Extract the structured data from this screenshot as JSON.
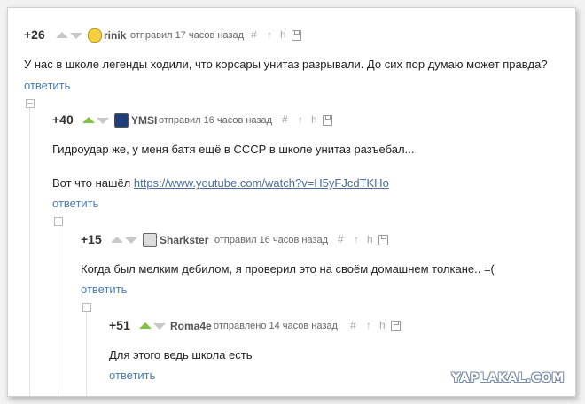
{
  "comments": [
    {
      "score": "+26",
      "author": "rinik",
      "sent": "отправил 17 часов назад",
      "text": "У нас в школе легенды ходили, что корсары унитаз разрывали. До сих пор думаю может правда?",
      "reply": "ответить",
      "avatar_icon": "cartoon-face-icon"
    },
    {
      "score": "+40",
      "author": "YMSI",
      "sent": "отправил 16 часов назад",
      "text": "Гидроудар же, у меня батя ещё в СССР в школе унитаз разъебал...",
      "text2_prefix": "Вот что нашёл ",
      "link": "https://www.youtube.com/watch?v=H5yFJcdTKHo",
      "reply": "ответить",
      "avatar_icon": "monitor-icon"
    },
    {
      "score": "+15",
      "author": "Sharkster",
      "sent": "отправил 16 часов назад",
      "text": "Когда был мелким дебилом, я проверил это на своём домашнем толкане.. =(",
      "reply": "ответить",
      "avatar_icon": "figure-icon"
    },
    {
      "score": "+51",
      "author": "Roma4e",
      "sent": "отправлено 14 часов назад",
      "text": "Для этого ведь школа есть",
      "reply": "ответить",
      "avatar_icon": "none"
    }
  ],
  "tools": {
    "hash": "#",
    "up": "↑",
    "branch": "h"
  },
  "watermark": "YAPLAKAL.COM",
  "colors": {
    "upvote_active": "#7fc242",
    "link": "#4a7cb5"
  }
}
